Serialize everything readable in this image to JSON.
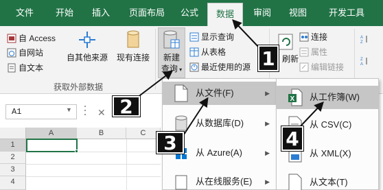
{
  "ribbon_tabs": [
    "文件",
    "开始",
    "插入",
    "页面布局",
    "公式",
    "数据",
    "审阅",
    "视图",
    "开发工具"
  ],
  "active_tab": "数据",
  "get_external": {
    "access": "自 Access",
    "web": "自网站",
    "text": "自文本",
    "other_sources": "自其他来源",
    "existing": "现有连接",
    "group_label": "获取外部数据"
  },
  "get_transform": {
    "new_query_line1": "新建",
    "new_query_line2": "查询",
    "show_queries": "显示查询",
    "from_table": "从表格",
    "recent_sources": "最近使用的源"
  },
  "connections": {
    "refresh_partial": "刷新",
    "connections": "连接",
    "properties": "属性",
    "edit_links": "编辑链接"
  },
  "name_box": "A1",
  "columns": [
    "A",
    "B",
    "C"
  ],
  "rows": [
    "1",
    "2",
    "3",
    "4"
  ],
  "menu1": [
    {
      "label": "从文件(F)",
      "has_arrow": true
    },
    {
      "label": "从数据库(D)",
      "has_arrow": true
    },
    {
      "label": "从 Azure(A)",
      "has_arrow": true
    },
    {
      "label": "从在线服务(E)",
      "has_arrow": true
    }
  ],
  "menu2": [
    {
      "label": "从工作簿(W)"
    },
    {
      "label": "从 CSV(C)"
    },
    {
      "label": "从 XML(X)"
    },
    {
      "label": "从文本(T)"
    }
  ],
  "badges": [
    "1",
    "2",
    "3",
    "4"
  ],
  "colors": {
    "excel_green": "#217346",
    "ribbon_bg": "#f3f3f3",
    "hover_gray": "#c6c6c6"
  }
}
